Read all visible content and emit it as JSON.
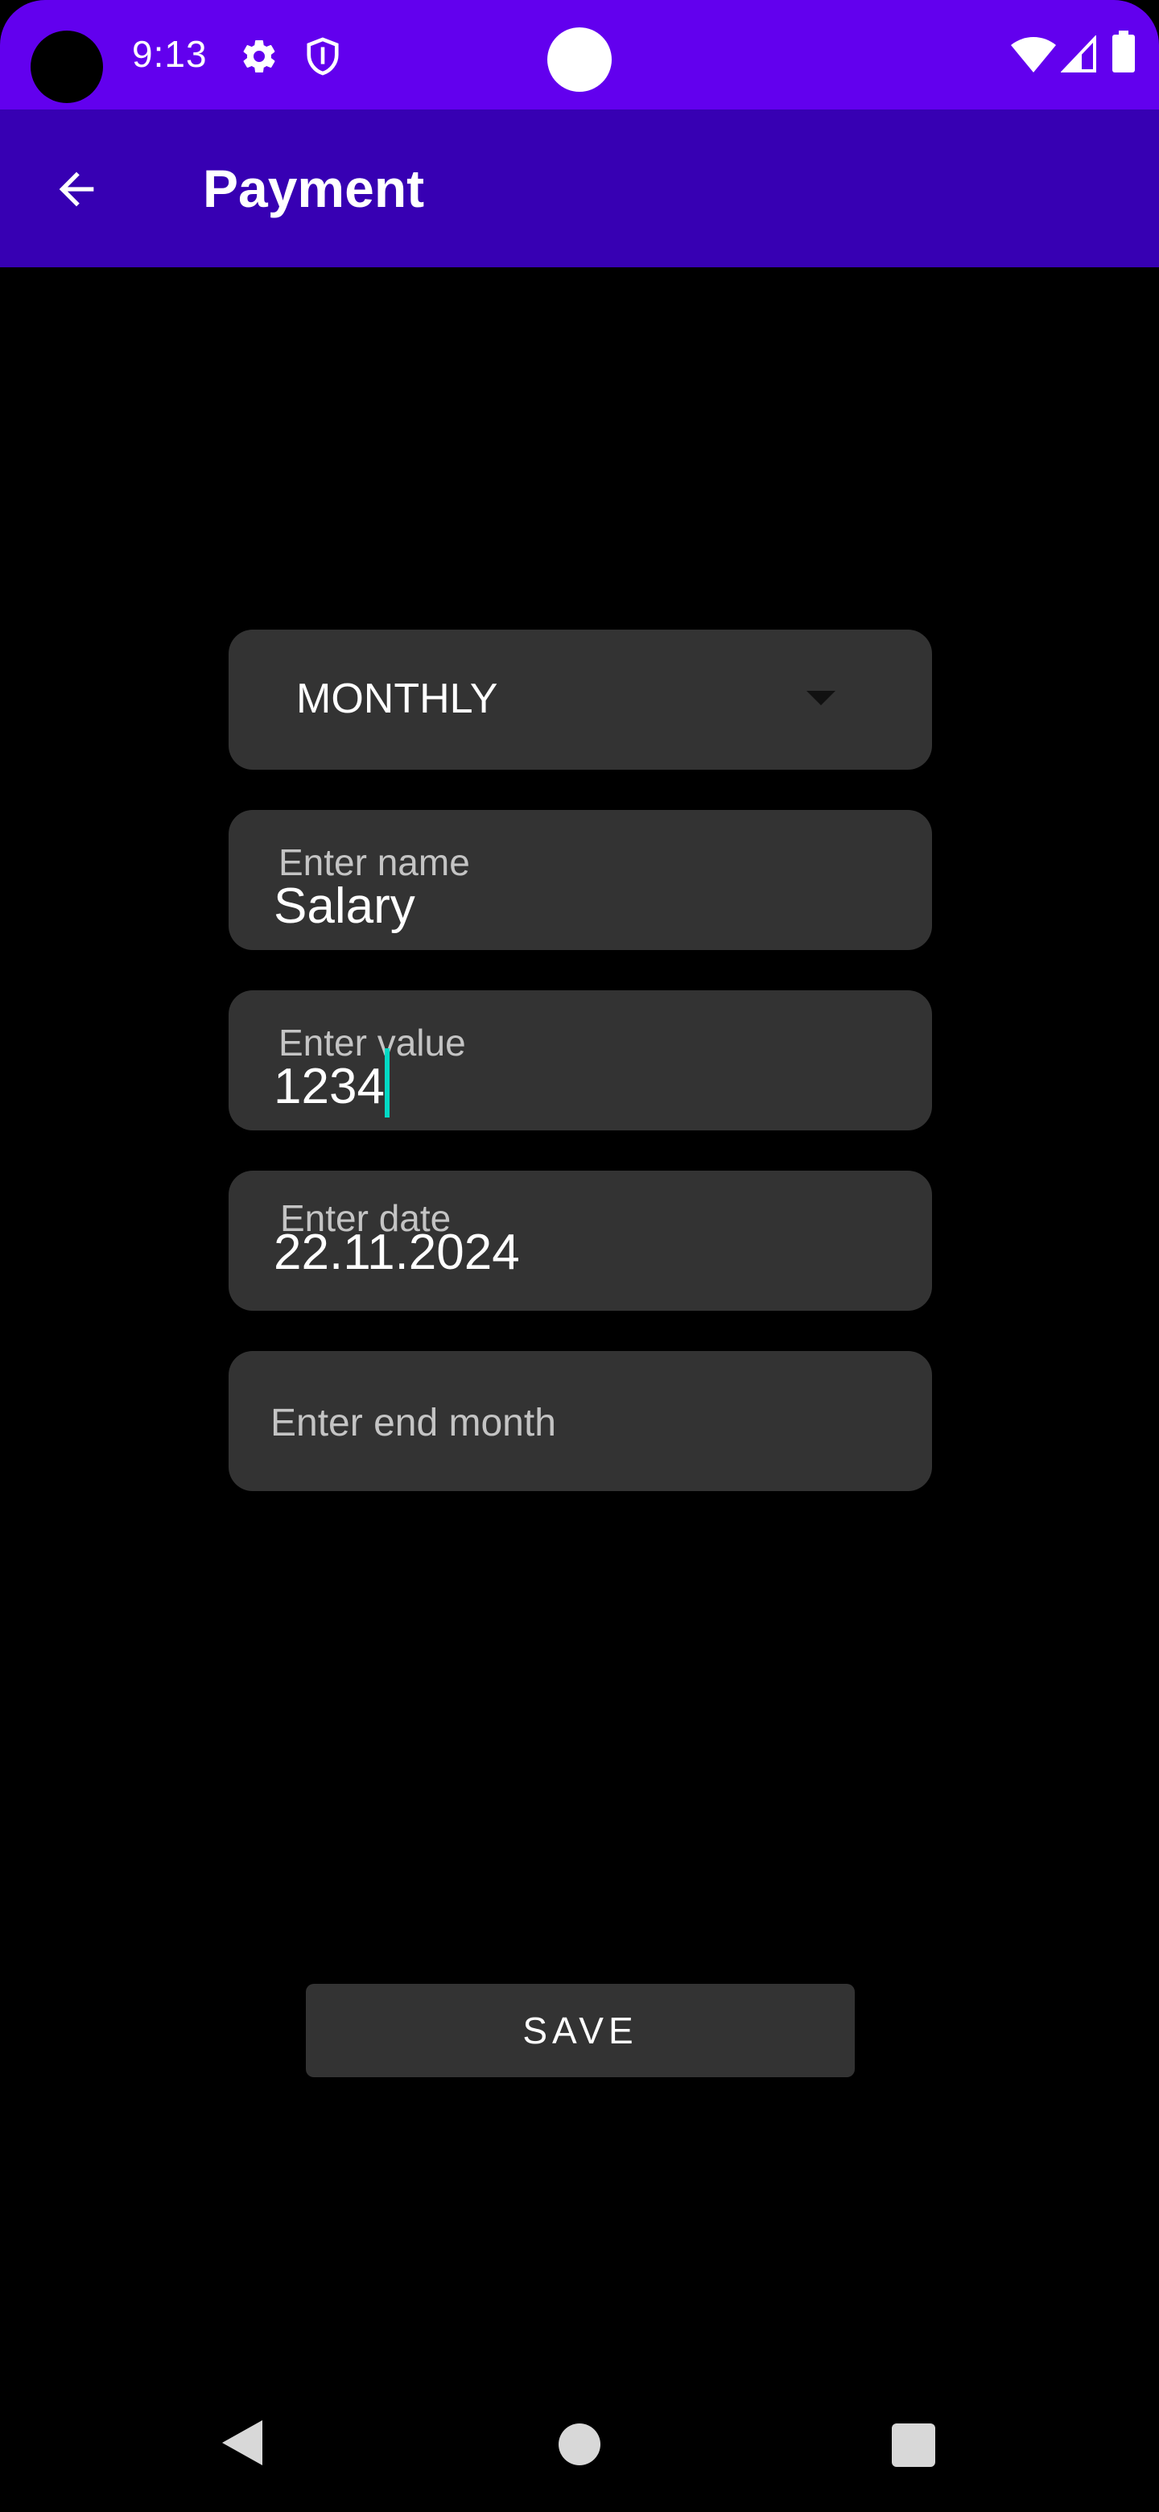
{
  "status_bar": {
    "time": "9:13",
    "background_color": "#6200ee",
    "icons": [
      "settings-gear-icon",
      "shield-icon",
      "wifi-icon",
      "signal-icon",
      "battery-icon"
    ]
  },
  "app_bar": {
    "title": "Payment",
    "background_color": "#3700b3",
    "back_icon": "arrow-back-icon"
  },
  "form": {
    "frequency": {
      "selected": "MONTHLY"
    },
    "name": {
      "label": "Enter name",
      "value": "Salary"
    },
    "value": {
      "label": "Enter value",
      "value": "1234"
    },
    "date": {
      "label": "Enter date",
      "value": "22.11.2024"
    },
    "end_month": {
      "placeholder": "Enter end month",
      "value": ""
    },
    "field_background": "#333333",
    "cursor_color": "#03dac5"
  },
  "actions": {
    "save_label": "SAVE"
  },
  "nav_bar": {
    "icons": [
      "nav-back-icon",
      "nav-home-icon",
      "nav-recents-icon"
    ]
  }
}
